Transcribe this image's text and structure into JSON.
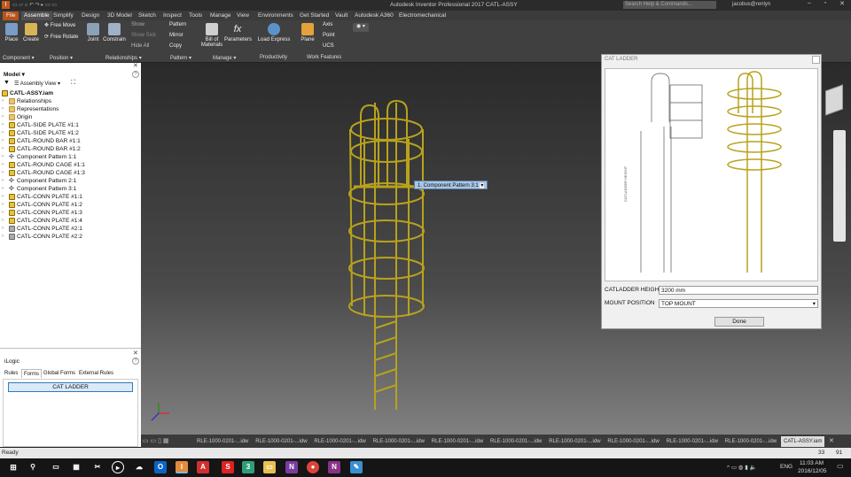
{
  "titlebar": {
    "title": "Autodesk Inventor Professional 2017    CATL-ASSY",
    "search_placeholder": "Search Help & Commands...",
    "user": "jacobus@renlyn"
  },
  "ribbon_tabs": [
    "File",
    "Assemble",
    "Simplify",
    "Design",
    "3D Model",
    "Sketch",
    "Inspect",
    "Tools",
    "Manage",
    "View",
    "Environments",
    "Get Started",
    "Vault",
    "Autodesk A360",
    "Electromechanical"
  ],
  "ribbon": {
    "place": "Place",
    "create": "Create",
    "free_move": "Free Move",
    "free_rotate": "Free Rotate",
    "joint": "Joint",
    "constrain": "Constrain",
    "show": "Show",
    "show_sick": "Show Sick",
    "hide_all": "Hide All",
    "pattern": "Pattern",
    "mirror": "Mirror",
    "copy": "Copy",
    "bom": "Bill of\nMaterials",
    "parameters": "Parameters",
    "load_express": "Load Express",
    "plane": "Plane",
    "axis": "Axis",
    "point": "Point",
    "ucs": "UCS",
    "panels": [
      "Component ▾",
      "Position ▾",
      "Relationships ▾",
      "Pattern ▾",
      "Manage ▾",
      "Productivity",
      "Work Features"
    ]
  },
  "browser": {
    "title": "Model ▾",
    "view": "Assembly View",
    "root": "CATL-ASSY.iam",
    "items": [
      {
        "label": "Relationships",
        "icon": "folder"
      },
      {
        "label": "Representations",
        "icon": "folder"
      },
      {
        "label": "Origin",
        "icon": "folder"
      },
      {
        "label": "CATL-SIDE PLATE #1:1",
        "icon": "part"
      },
      {
        "label": "CATL-SIDE PLATE #1:2",
        "icon": "part"
      },
      {
        "label": "CATL-ROUND BAR #1:1",
        "icon": "part"
      },
      {
        "label": "CATL-ROUND BAR #1:2",
        "icon": "part"
      },
      {
        "label": "Component Pattern 1:1",
        "icon": "pattern"
      },
      {
        "label": "CATL-ROUND CAGE #1:1",
        "icon": "part"
      },
      {
        "label": "CATL-ROUND CAGE #1:3",
        "icon": "part"
      },
      {
        "label": "Component Pattern 2:1",
        "icon": "pattern"
      },
      {
        "label": "Component Pattern 3:1",
        "icon": "pattern"
      },
      {
        "label": "CATL-CONN PLATE #1:1",
        "icon": "part"
      },
      {
        "label": "CATL-CONN PLATE #1:2",
        "icon": "part"
      },
      {
        "label": "CATL-CONN PLATE #1:3",
        "icon": "part"
      },
      {
        "label": "CATL-CONN PLATE #1:4",
        "icon": "part"
      },
      {
        "label": "CATL-CONN PLATE #2:1",
        "icon": "plate2"
      },
      {
        "label": "CATL-CONN PLATE #2:2",
        "icon": "plate2"
      }
    ]
  },
  "ilogic": {
    "title": "iLogic",
    "tabs": [
      "Rules",
      "Forms",
      "Global Forms",
      "External Rules"
    ],
    "button": "CAT LADDER"
  },
  "viewport": {
    "tooltip": "1. Component Pattern 3:1",
    "side_label": "CATLADDER HEIGHT"
  },
  "dialog": {
    "title": "CAT LADDER",
    "height_label": "CATLADDER HEIGHT",
    "height_value": "3200 mm",
    "mount_label": "MOUNT POSITION",
    "mount_value": "TOP MOUNT",
    "done": "Done"
  },
  "doctabs": [
    "RLE-1000-0201-...idw",
    "RLE-1000-0201-...idw",
    "RLE-1000-0201-...idw",
    "RLE-1000-0201-...idw",
    "RLE-1000-0201-...idw",
    "RLE-1000-0201-...idw",
    "RLE-1000-0201-...idw",
    "RLE-1000-0201-...idw",
    "RLE-1000-0201-...idw",
    "RLE-1000-0201-...idw",
    "CATL-ASSY.iam"
  ],
  "status": {
    "text": "Ready",
    "n1": "33",
    "n2": "91"
  },
  "taskbar": {
    "lang": "ENG",
    "time": "11:03 AM",
    "date": "2016/12/05"
  },
  "colors": {
    "accent": "#b5531b",
    "ladder": "#b8a21c"
  }
}
